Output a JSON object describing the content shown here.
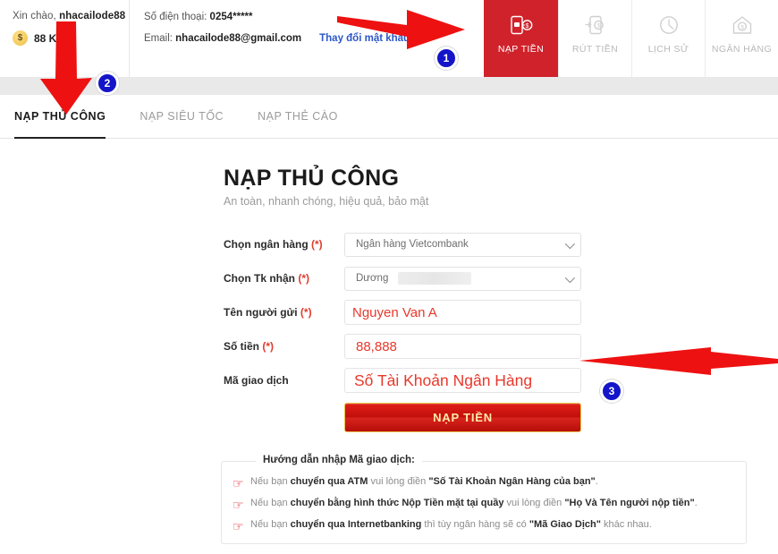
{
  "header": {
    "greeting_prefix": "Xin chào,",
    "username": "nhacailode88",
    "coin_symbol": "$",
    "balance": "88 K",
    "phone_label": "Số điện thoại:",
    "phone_value": "0254*****",
    "email_label": "Email:",
    "email_value": "nhacailode88@gmail.com",
    "change_password": "Thay đổi mật khẩu"
  },
  "nav": {
    "items": [
      {
        "label": "NẠP TIỀN",
        "icon": "deposit-phone-coin-icon",
        "active": true
      },
      {
        "label": "RÚT TIỀN",
        "icon": "withdraw-phone-arrow-icon",
        "active": false
      },
      {
        "label": "LỊCH SỬ",
        "icon": "clock-history-icon",
        "active": false
      },
      {
        "label": "NGÂN HÀNG",
        "icon": "bank-house-dollar-icon",
        "active": false
      }
    ]
  },
  "subtabs": [
    {
      "label": "NẠP THỦ CÔNG",
      "active": true
    },
    {
      "label": "NẠP SIÊU TỐC",
      "active": false
    },
    {
      "label": "NẠP THẺ CÀO",
      "active": false
    }
  ],
  "form": {
    "title": "NẠP THỦ CÔNG",
    "subtitle": "An toàn, nhanh chóng, hiệu quả, bảo mật",
    "bank_label": "Chọn ngân hàng (*)",
    "bank_value": "Ngân hàng Vietcombank",
    "account_label": "Chọn Tk nhận (*)",
    "account_value": "Dương",
    "sender_label": "Tên người gửi (*)",
    "sender_value": "Nguyen Van A",
    "amount_label": "Số tiền (*)",
    "amount_value": "88,888",
    "code_label": "Mã giao dịch",
    "code_value": "Số Tài Khoản Ngân Hàng",
    "submit_label": "NẠP TIỀN"
  },
  "guide": {
    "legend": "Hướng dẫn nhập Mã giao dịch:",
    "items": [
      {
        "p1": "Nếu bạn ",
        "b1": "chuyển qua ATM",
        "p2": " vui lòng điền ",
        "b2": "\"Số Tài Khoản Ngân Hàng của bạn\"",
        "p3": "."
      },
      {
        "p1": "Nếu bạn ",
        "b1": "chuyển bằng hình thức Nộp Tiền mặt tại quầy",
        "p2": " vui lòng điền ",
        "b2": "\"Họ Và Tên người nộp tiền\"",
        "p3": "."
      },
      {
        "p1": "Nếu bạn ",
        "b1": "chuyển qua Internetbanking",
        "p2": " thì tùy ngân hàng sẽ có ",
        "b2": "\"Mã Giao Dịch\"",
        "p3": " khác nhau."
      }
    ]
  },
  "annotations": {
    "badge1": "1",
    "badge2": "2",
    "badge3": "3",
    "arrow_color": "#ee1111"
  },
  "colors": {
    "brand_red": "#d0222b",
    "link_blue": "#2b57c7",
    "badge_blue": "#1414c8",
    "input_red": "#e8382b"
  }
}
